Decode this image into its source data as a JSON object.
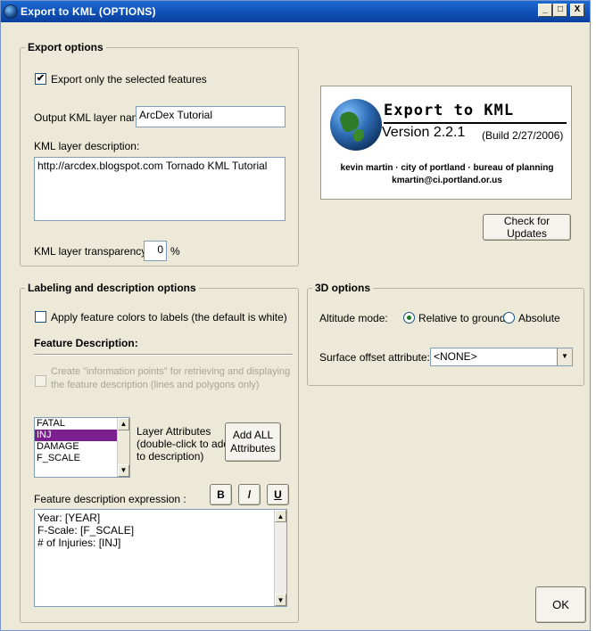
{
  "window": {
    "title": "Export to KML (OPTIONS)",
    "minimize_label": "_",
    "maximize_label": "□",
    "close_label": "X"
  },
  "export_options": {
    "group_title": "Export options",
    "selected_only_label": "Export only the selected features",
    "selected_only_checked": true,
    "layer_name_label": "Output KML layer name:",
    "layer_name_value": "ArcDex Tutorial",
    "description_label": "KML layer description:",
    "description_value": "http://arcdex.blogspot.com Tornado KML Tutorial",
    "transparency_label": "KML layer transparency:",
    "transparency_value": "0",
    "transparency_unit": "%"
  },
  "about": {
    "title": "Export to KML",
    "version": "Version 2.2.1",
    "build": "(Build 2/27/2006)",
    "credit_line1": "kevin martin · city of portland · bureau of planning",
    "credit_line2": "kmartin@ci.portland.or.us"
  },
  "check_updates_label": "Check for Updates",
  "labeling": {
    "group_title": "Labeling and description options",
    "apply_colors_label": "Apply feature colors to labels (the default is white)",
    "apply_colors_checked": false,
    "feature_description_heading": "Feature Description:",
    "info_points_line1": "Create \"information points\" for retrieving and displaying",
    "info_points_line2": "the feature description (lines and polygons only)",
    "attributes": [
      "FATAL",
      "INJ",
      "DAMAGE",
      "F_SCALE"
    ],
    "selected_attribute": "INJ",
    "layer_attributes_line1": "Layer Attributes",
    "layer_attributes_line2": "(double-click to add",
    "layer_attributes_line3": "to description)",
    "add_all_line1": "Add ALL",
    "add_all_line2": "Attributes",
    "expression_label": "Feature description expression :",
    "bold_label": "B",
    "italic_label": "/",
    "underline_label": "U",
    "expression_lines": [
      "Year: [YEAR]",
      "F-Scale: [F_SCALE]",
      "# of Injuries: [INJ]"
    ]
  },
  "options_3d": {
    "group_title": "3D options",
    "altitude_label": "Altitude mode:",
    "relative_label": "Relative to ground",
    "absolute_label": "Absolute",
    "selected_mode": "relative",
    "offset_label": "Surface offset attribute:",
    "offset_value": "<NONE>"
  },
  "ok_label": "OK",
  "colors": {
    "titlebar": "#1152b8",
    "selection": "#7b1f8f",
    "dialog_face": "#ece9d8"
  }
}
